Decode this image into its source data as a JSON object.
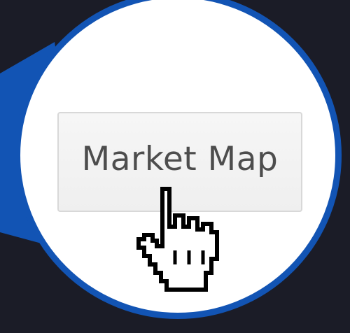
{
  "button": {
    "label": "Market Map"
  },
  "cursor": {
    "icon": "hand-pointer-icon"
  },
  "colors": {
    "background": "#1b1c27",
    "accent": "#1254b4",
    "button_text": "#4d4d4d"
  }
}
